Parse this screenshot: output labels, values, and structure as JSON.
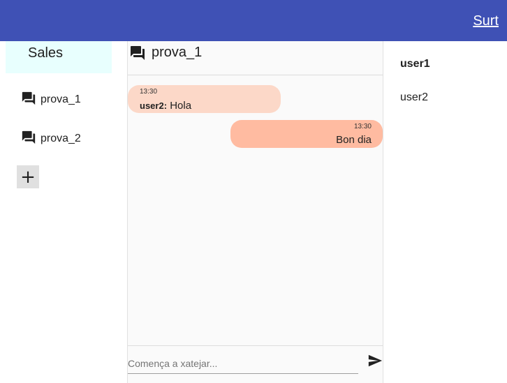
{
  "header": {
    "logout_label": "Surt",
    "bar_color": "#3f51b5"
  },
  "sidebar": {
    "title": "Sales",
    "rooms": [
      {
        "label": "prova_1",
        "icon": "forum-icon"
      },
      {
        "label": "prova_2",
        "icon": "forum-icon"
      }
    ],
    "add_label": "+"
  },
  "chat": {
    "room_title": "prova_1",
    "messages": [
      {
        "direction": "incoming",
        "time": "13:30",
        "sender": "user2:",
        "text": "Hola",
        "color": "#fcd8c8"
      },
      {
        "direction": "outgoing",
        "time": "13:30",
        "text": "Bon dia",
        "color": "#ffbba1"
      }
    ],
    "composer": {
      "placeholder": "Comença a xatejar...",
      "value": "",
      "send_icon": "send-icon"
    }
  },
  "users": [
    {
      "name": "user1",
      "bold": true
    },
    {
      "name": "user2",
      "bold": false
    }
  ]
}
